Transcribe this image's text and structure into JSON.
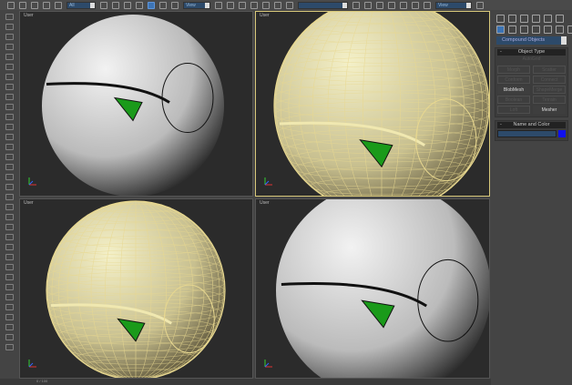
{
  "toolbar": {
    "selection_filter": "All",
    "ref_coord": "View",
    "named_selection": "",
    "view_dropdown": "View",
    "active_tool": "select-and-move"
  },
  "viewports": [
    {
      "label": "User",
      "shading": "smooth"
    },
    {
      "label": "User",
      "shading": "wireframe"
    },
    {
      "label": "User",
      "shading": "wireframe"
    },
    {
      "label": "User",
      "shading": "smooth"
    }
  ],
  "panel": {
    "category": "Compound Objects",
    "object_type": {
      "title": "Object Type",
      "autogrid": "AutoGrid",
      "buttons": [
        {
          "label": "Morph",
          "enabled": false
        },
        {
          "label": "Scatter",
          "enabled": false
        },
        {
          "label": "Conform",
          "enabled": false
        },
        {
          "label": "Connect",
          "enabled": false
        },
        {
          "label": "BlobMesh",
          "enabled": true
        },
        {
          "label": "ShapeMerge",
          "enabled": false
        },
        {
          "label": "Boolean",
          "enabled": false
        },
        {
          "label": "Terrain",
          "enabled": false
        },
        {
          "label": "Loft",
          "enabled": false
        },
        {
          "label": "Mesher",
          "enabled": true
        }
      ]
    },
    "name_color": {
      "title": "Name and Color",
      "name": "",
      "color": "#1010ee"
    },
    "collapse": "-"
  },
  "status": {
    "text": "0 / 100"
  },
  "colors": {
    "wire": "#e8d890",
    "active_border": "#d8c87a",
    "accent": "#3a7fd0",
    "cut_green": "#1a9a1a"
  }
}
